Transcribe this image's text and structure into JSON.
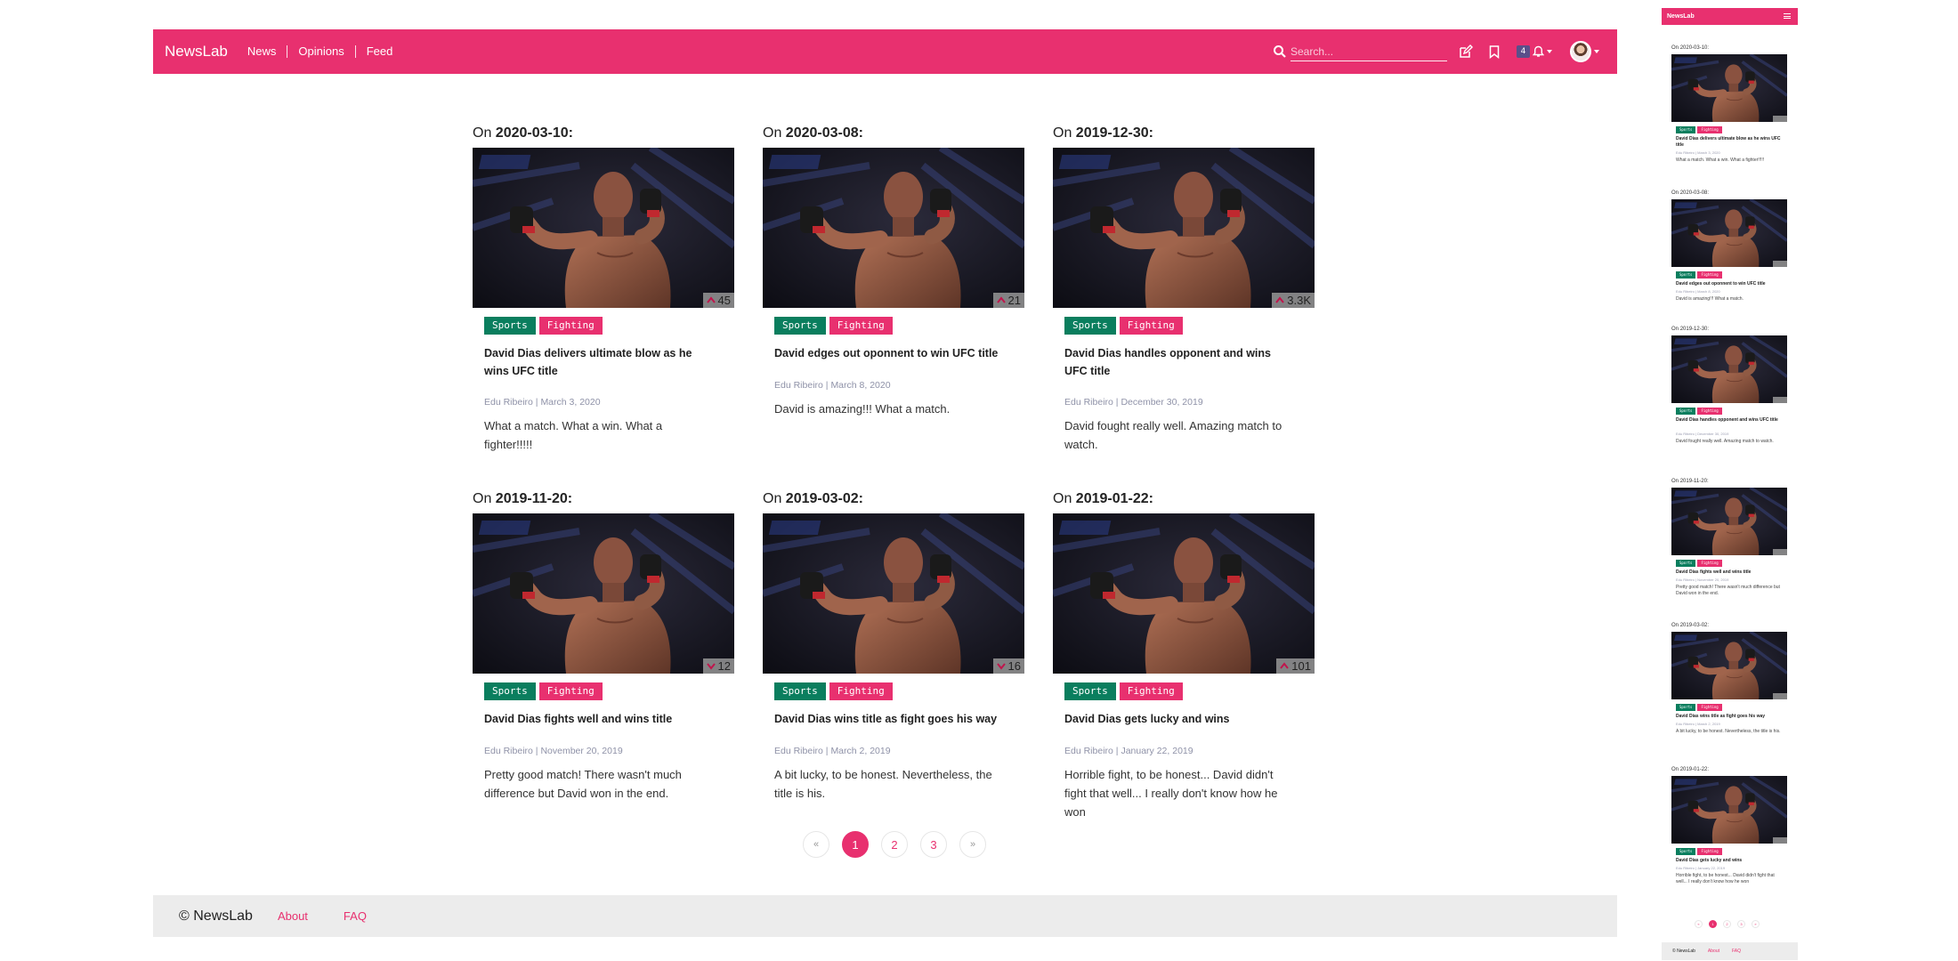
{
  "navbar": {
    "brand": "NewsLab",
    "links": [
      "News",
      "Opinions",
      "Feed"
    ],
    "search_placeholder": "Search...",
    "notification_count": "4"
  },
  "articles": [
    {
      "date": "2020-03-10",
      "votes": "45",
      "vote_direction": "up",
      "tags": [
        "Sports",
        "Fighting"
      ],
      "title": "David Dias delivers ultimate blow as he wins UFC title",
      "author": "Edu Ribeiro",
      "published": "March 3, 2020",
      "excerpt": "What a match. What a win. What a fighter!!!!!"
    },
    {
      "date": "2020-03-08",
      "votes": "21",
      "vote_direction": "up",
      "tags": [
        "Sports",
        "Fighting"
      ],
      "title": "David edges out oponnent to win UFC title",
      "author": "Edu Ribeiro",
      "published": "March 8, 2020",
      "excerpt": "David is amazing!!! What a match."
    },
    {
      "date": "2019-12-30",
      "votes": "3.3K",
      "vote_direction": "up",
      "tags": [
        "Sports",
        "Fighting"
      ],
      "title": "David Dias handles opponent and wins UFC title",
      "author": "Edu Ribeiro",
      "published": "December 30, 2019",
      "excerpt": "David fought really well. Amazing match to watch."
    },
    {
      "date": "2019-11-20",
      "votes": "12",
      "vote_direction": "down",
      "tags": [
        "Sports",
        "Fighting"
      ],
      "title": "David Dias fights well and wins title",
      "author": "Edu Ribeiro",
      "published": "November 20, 2019",
      "excerpt": "Pretty good match! There wasn't much difference but David won in the end."
    },
    {
      "date": "2019-03-02",
      "votes": "16",
      "vote_direction": "down",
      "tags": [
        "Sports",
        "Fighting"
      ],
      "title": "David Dias wins title as fight goes his way",
      "author": "Edu Ribeiro",
      "published": "March 2, 2019",
      "excerpt": "A bit lucky, to be honest. Nevertheless, the title is his."
    },
    {
      "date": "2019-01-22",
      "votes": "101",
      "vote_direction": "up",
      "tags": [
        "Sports",
        "Fighting"
      ],
      "title": "David Dias gets lucky and wins",
      "author": "Edu Ribeiro",
      "published": "January 22, 2019",
      "excerpt": "Horrible fight, to be honest... David didn't fight that well... I really don't know how he won"
    }
  ],
  "labels": {
    "date_prefix": "On",
    "date_suffix": ":",
    "meta_separator": "|"
  },
  "pagination": {
    "prev": "«",
    "pages": [
      "1",
      "2",
      "3"
    ],
    "next": "»",
    "current": "1"
  },
  "footer": {
    "brand": "© NewsLab",
    "links": [
      "About",
      "FAQ"
    ]
  },
  "colors": {
    "primary": "#e8306f",
    "sports_tag": "#0a7e5e",
    "footer_bg": "#ececec",
    "badge": "#5a4f8a"
  },
  "icons": [
    "search-icon",
    "edit-icon",
    "bookmark-icon",
    "bell-icon",
    "menu-icon",
    "arrow-up-icon",
    "arrow-down-icon"
  ]
}
